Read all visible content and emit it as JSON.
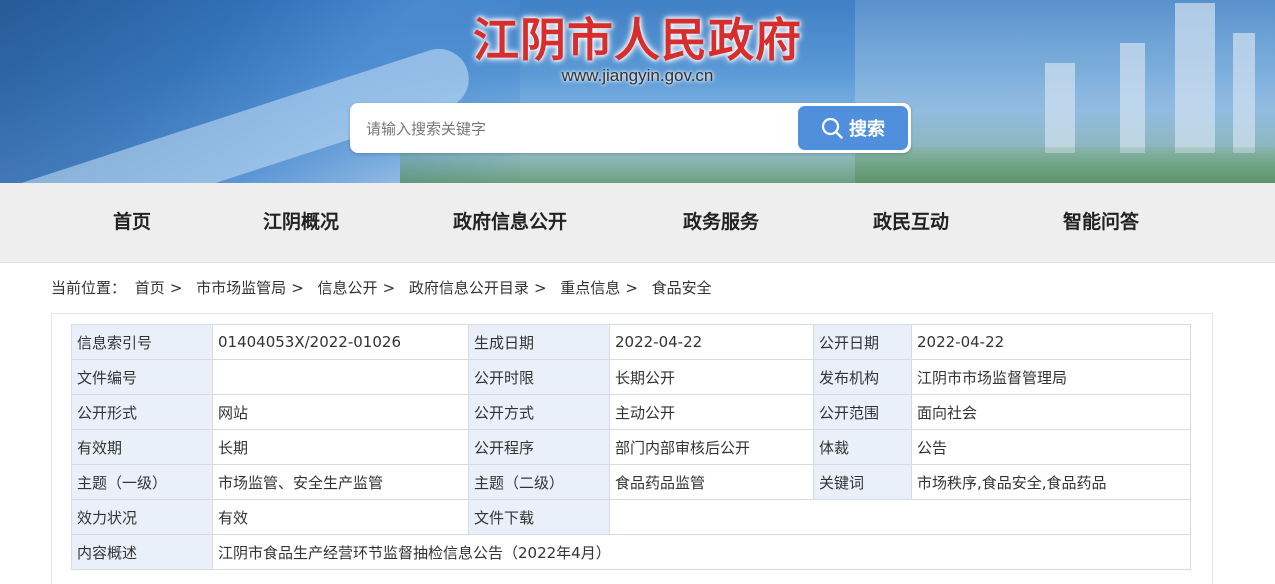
{
  "header": {
    "site_title": "江阴市人民政府",
    "site_url": "www.jiangyin.gov.cn"
  },
  "search": {
    "placeholder": "请输入搜索关键字",
    "button_label": "搜索",
    "button_icon": "search-icon"
  },
  "nav": {
    "items": [
      {
        "label": "首页"
      },
      {
        "label": "江阴概况"
      },
      {
        "label": "政府信息公开"
      },
      {
        "label": "政务服务"
      },
      {
        "label": "政民互动"
      },
      {
        "label": "智能问答"
      }
    ]
  },
  "breadcrumb": {
    "prefix": "当前位置：",
    "separator": ">",
    "items": [
      "首页",
      "市市场监管局",
      "信息公开",
      "政府信息公开目录",
      "重点信息",
      "食品安全"
    ]
  },
  "info_table": {
    "rows": [
      [
        {
          "k": "信息索引号",
          "v": "01404053X/2022-01026"
        },
        {
          "k": "生成日期",
          "v": "2022-04-22"
        },
        {
          "k": "公开日期",
          "v": "2022-04-22"
        }
      ],
      [
        {
          "k": "文件编号",
          "v": ""
        },
        {
          "k": "公开时限",
          "v": "长期公开"
        },
        {
          "k": "发布机构",
          "v": "江阴市市场监督管理局"
        }
      ],
      [
        {
          "k": "公开形式",
          "v": "网站"
        },
        {
          "k": "公开方式",
          "v": "主动公开"
        },
        {
          "k": "公开范围",
          "v": "面向社会"
        }
      ],
      [
        {
          "k": "有效期",
          "v": "长期"
        },
        {
          "k": "公开程序",
          "v": "部门内部审核后公开"
        },
        {
          "k": "体裁",
          "v": "公告"
        }
      ],
      [
        {
          "k": "主题（一级）",
          "v": "市场监管、安全生产监管"
        },
        {
          "k": "主题（二级）",
          "v": "食品药品监管"
        },
        {
          "k": "关键词",
          "v": "市场秩序,食品安全,食品药品"
        }
      ]
    ],
    "status_row": {
      "k1": "效力状况",
      "v1": "有效",
      "k2": "文件下载"
    },
    "summary_row": {
      "k": "内容概述",
      "v": "江阴市食品生产经营环节监督抽检信息公告（2022年4月）"
    }
  },
  "colors": {
    "title_red": "#d72d2d",
    "search_button": "#4f8fdc",
    "nav_bg": "#eeeeee",
    "key_cell_bg": "#eaf0fa"
  }
}
